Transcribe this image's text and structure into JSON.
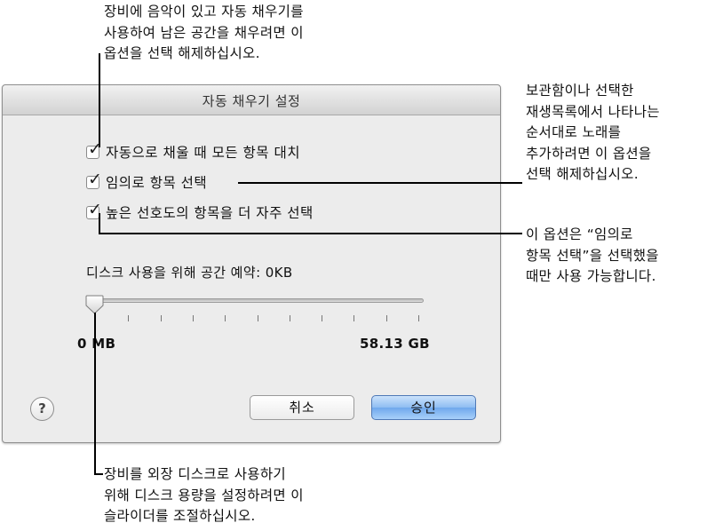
{
  "callouts": {
    "top": "장비에 음악이 있고 자동 채우기를\n사용하여 남은 공간을 채우려면 이\n옵션을 선택 해제하십시오.",
    "right_top": "보관함이나 선택한\n재생목록에서 나타나는\n순서대로 노래를\n추가하려면 이 옵션을\n선택 해제하십시오.",
    "right_mid": "이 옵션은 “임의로\n항목 선택”을 선택했을\n때만 사용 가능합니다.",
    "bottom": "장비를 외장 디스크로 사용하기\n위해 디스크 용량을 설정하려면 이\n슬라이더를 조절하십시오."
  },
  "dialog": {
    "title": "자동 채우기 설정",
    "options": [
      {
        "label": "자동으로 채울 때 모든 항목 대치",
        "checked": true
      },
      {
        "label": "임의로 항목 선택",
        "checked": true
      },
      {
        "label": "높은 선호도의 항목을 더 자주 선택",
        "checked": true
      }
    ],
    "reserve_label": "디스크 사용을 위해 공간 예약:",
    "reserve_value": "0KB",
    "slider": {
      "min_label": "0 MB",
      "max_label": "58.13 GB",
      "value_fraction": 0
    },
    "help_label": "?",
    "cancel_label": "취소",
    "ok_label": "승인"
  },
  "colors": {
    "dialog_bg": "#ececec",
    "default_button": "#8fbdf2"
  }
}
